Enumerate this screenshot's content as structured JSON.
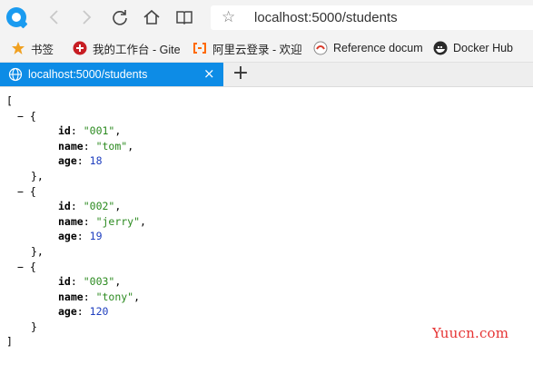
{
  "toolbar": {
    "url": "localhost:5000/students",
    "back_icon": "chevron-left-icon",
    "forward_icon": "chevron-right-icon",
    "reload_icon": "reload-icon",
    "home_icon": "home-icon",
    "reader_icon": "book-icon",
    "star_icon": "star-icon"
  },
  "bookmarks": [
    {
      "label": "书签",
      "icon": "star-icon",
      "color": "#f0a020"
    },
    {
      "label": "我的工作台 - Gitee",
      "icon": "gitee-icon",
      "color": "#c71d23"
    },
    {
      "label": "阿里云登录 - 欢迎",
      "icon": "aliyun-icon",
      "color": "#ff6a00"
    },
    {
      "label": "Reference docum",
      "icon": "reference-icon",
      "color": "#d93a2a"
    },
    {
      "label": "Docker Hub",
      "icon": "docker-icon",
      "color": "#2a2a2a"
    }
  ],
  "tab": {
    "title": "localhost:5000/students",
    "close_symbol": "×",
    "accent": "#0d8ce6",
    "new_tab_symbol": "+"
  },
  "json_view": {
    "open_bracket": "[",
    "close_bracket": "]",
    "toggle": "−",
    "open_brace": "{",
    "close_brace_comma": "},",
    "close_brace": "}",
    "items": [
      {
        "id": "\"001\"",
        "name": "\"tom\"",
        "age": "18"
      },
      {
        "id": "\"002\"",
        "name": "\"jerry\"",
        "age": "19"
      },
      {
        "id": "\"003\"",
        "name": "\"tony\"",
        "age": "120"
      }
    ],
    "key_id": "id",
    "key_name": "name",
    "key_age": "age"
  },
  "watermark": "Yuucn.com"
}
